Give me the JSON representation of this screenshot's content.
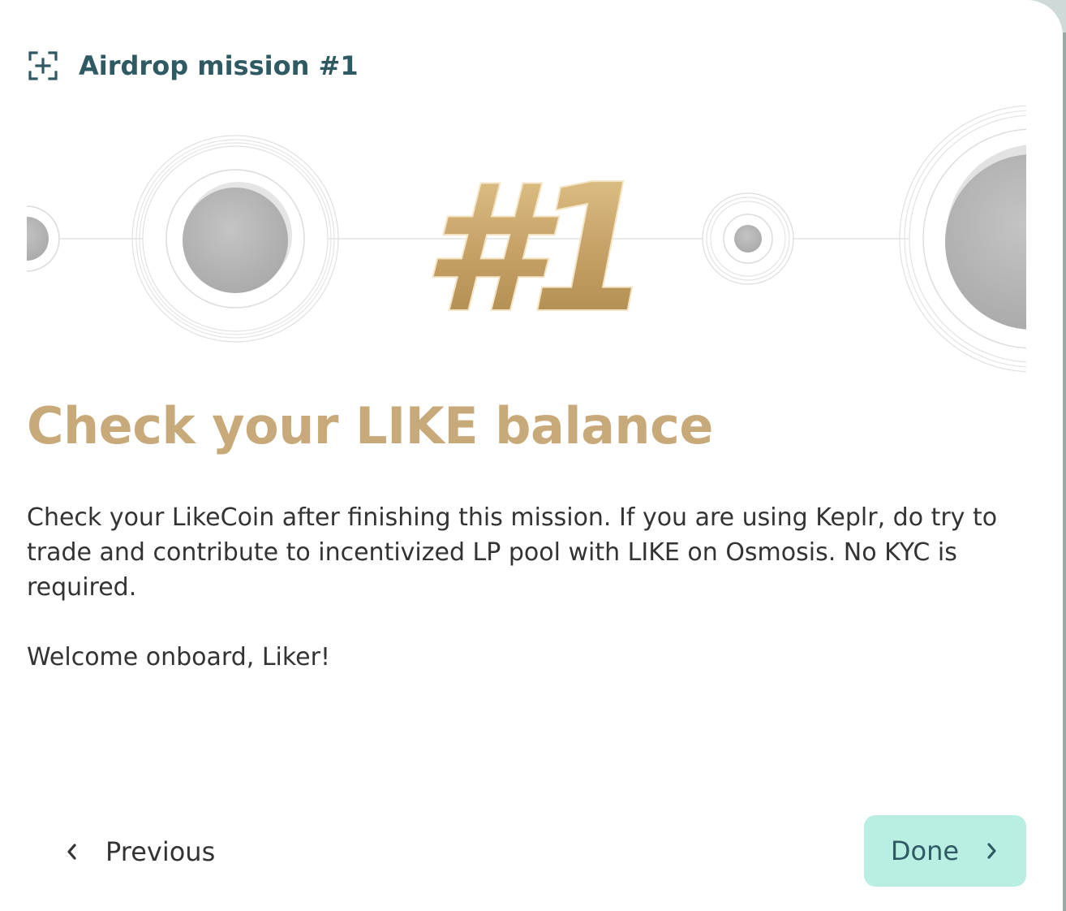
{
  "header": {
    "icon": "add-scan-icon",
    "title": "Airdrop mission #1"
  },
  "banner": {
    "badge_text": "#1",
    "badge_color": "#c9a56b"
  },
  "content": {
    "heading": "Check your LIKE balance",
    "paragraph": "Check your LikeCoin after finishing this mission. If you are using Keplr, do try to trade and contribute to incentivized LP pool with LIKE on Osmosis. No KYC is required.",
    "welcome": "Welcome onboard, Liker!"
  },
  "footer": {
    "previous_label": "Previous",
    "previous_icon": "chevron-left-icon",
    "done_label": "Done",
    "done_icon": "chevron-right-icon"
  },
  "colors": {
    "heading": "#c8a97a",
    "title": "#2f5a63",
    "done_bg": "#b9efe3"
  }
}
